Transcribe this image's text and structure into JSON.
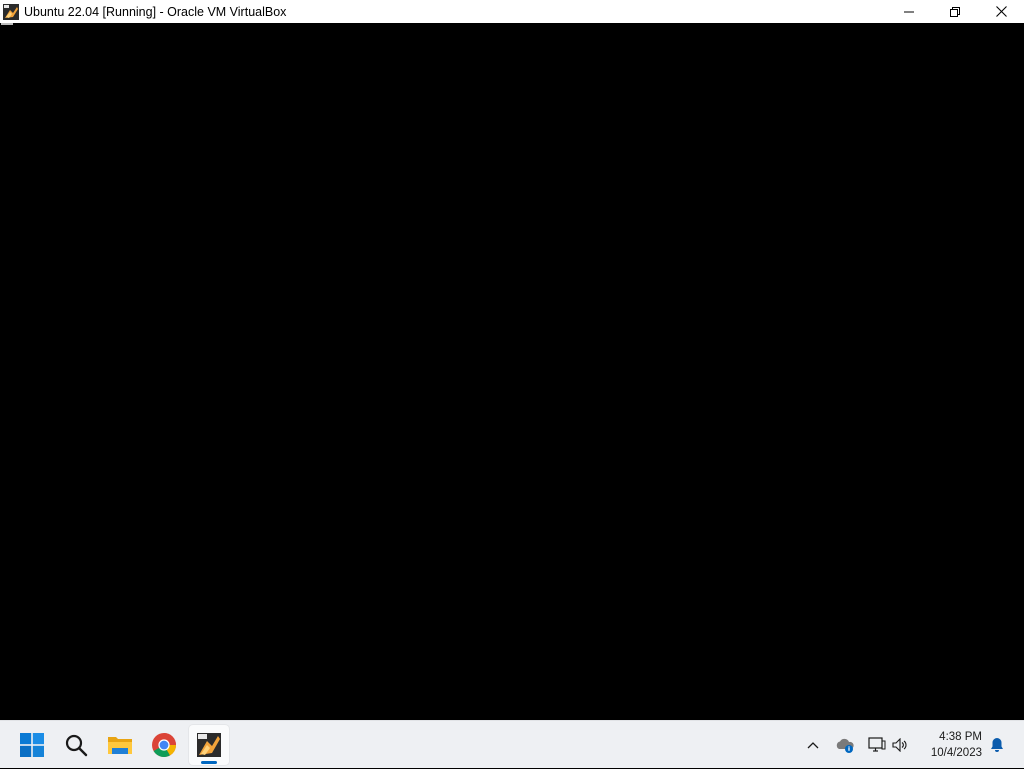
{
  "window": {
    "title": "Ubuntu 22.04 [Running] - Oracle VM VirtualBox",
    "icon": "virtualbox-app-icon",
    "buttons": {
      "minimize": "minimize-icon",
      "restore": "restore-icon",
      "close": "close-icon"
    }
  },
  "vm": {
    "screen_color": "#000000",
    "cursor": "text-cursor"
  },
  "taskbar": {
    "items": [
      {
        "icon": "windows-start-icon"
      },
      {
        "icon": "search-icon"
      },
      {
        "icon": "file-explorer-icon"
      },
      {
        "icon": "chrome-icon"
      },
      {
        "icon": "virtualbox-icon",
        "active": true
      }
    ],
    "tray": {
      "icons": [
        "chevron-up-icon",
        "onedrive-icon",
        "network-icon",
        "volume-icon",
        "notification-bell-icon"
      ]
    },
    "clock": {
      "time": "4:38 PM",
      "date": "10/4/2023"
    },
    "accent_color": "#0067c0"
  }
}
